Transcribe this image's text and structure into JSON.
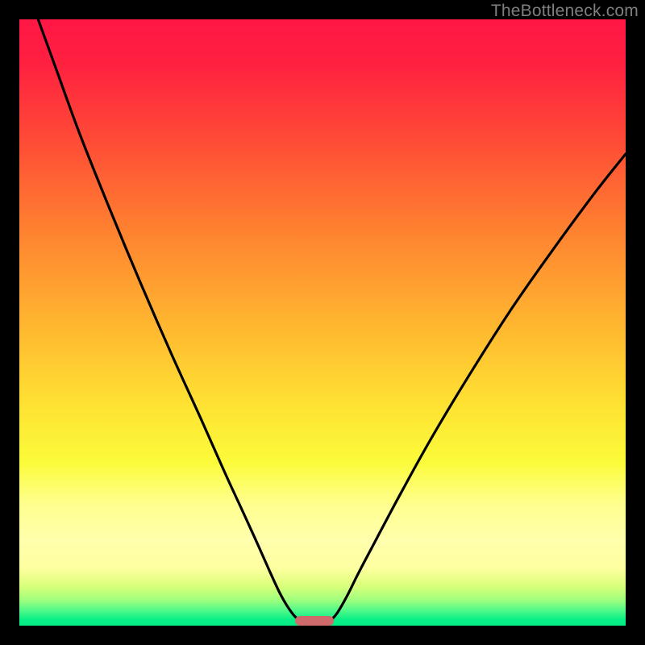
{
  "watermark": "TheBottleneck.com",
  "chart_data": {
    "type": "line",
    "title": "",
    "xlabel": "",
    "ylabel": "",
    "xlim": [
      0,
      100
    ],
    "ylim": [
      0,
      100
    ],
    "gradient_stops": [
      {
        "offset": 0.0,
        "color": "#ff1745"
      },
      {
        "offset": 0.07,
        "color": "#ff2040"
      },
      {
        "offset": 0.2,
        "color": "#ff4b36"
      },
      {
        "offset": 0.35,
        "color": "#ff8230"
      },
      {
        "offset": 0.5,
        "color": "#ffb530"
      },
      {
        "offset": 0.63,
        "color": "#ffe032"
      },
      {
        "offset": 0.73,
        "color": "#fbfb3a"
      },
      {
        "offset": 0.8,
        "color": "#ffff8f"
      },
      {
        "offset": 0.86,
        "color": "#ffffad"
      },
      {
        "offset": 0.905,
        "color": "#feffa0"
      },
      {
        "offset": 0.935,
        "color": "#d9ff7a"
      },
      {
        "offset": 0.958,
        "color": "#9fff7e"
      },
      {
        "offset": 0.975,
        "color": "#50f98a"
      },
      {
        "offset": 0.99,
        "color": "#09ef85"
      },
      {
        "offset": 1.0,
        "color": "#04ee85"
      }
    ],
    "series": [
      {
        "name": "left-curve",
        "x": [
          3.1,
          6,
          10,
          15,
          20,
          25,
          30,
          34,
          37,
          39.5,
          41.5,
          43,
          44.2,
          45.2,
          46
        ],
        "y": [
          100,
          92,
          81,
          68.5,
          56.5,
          45,
          34,
          25,
          18.5,
          13,
          8.5,
          5.3,
          3.2,
          1.8,
          1.0
        ]
      },
      {
        "name": "right-curve",
        "x": [
          51.5,
          52.5,
          54,
          56,
          59,
          63,
          68,
          74,
          81,
          88,
          95,
          100
        ],
        "y": [
          1.0,
          2.2,
          4.8,
          8.8,
          14.5,
          22,
          31,
          41,
          52,
          62,
          71.5,
          77.8
        ]
      }
    ],
    "marker": {
      "name": "bottleneck-marker",
      "x_center": 48.7,
      "width_pct": 6.4,
      "height_pct": 1.6,
      "color": "#ce6a6c"
    }
  }
}
